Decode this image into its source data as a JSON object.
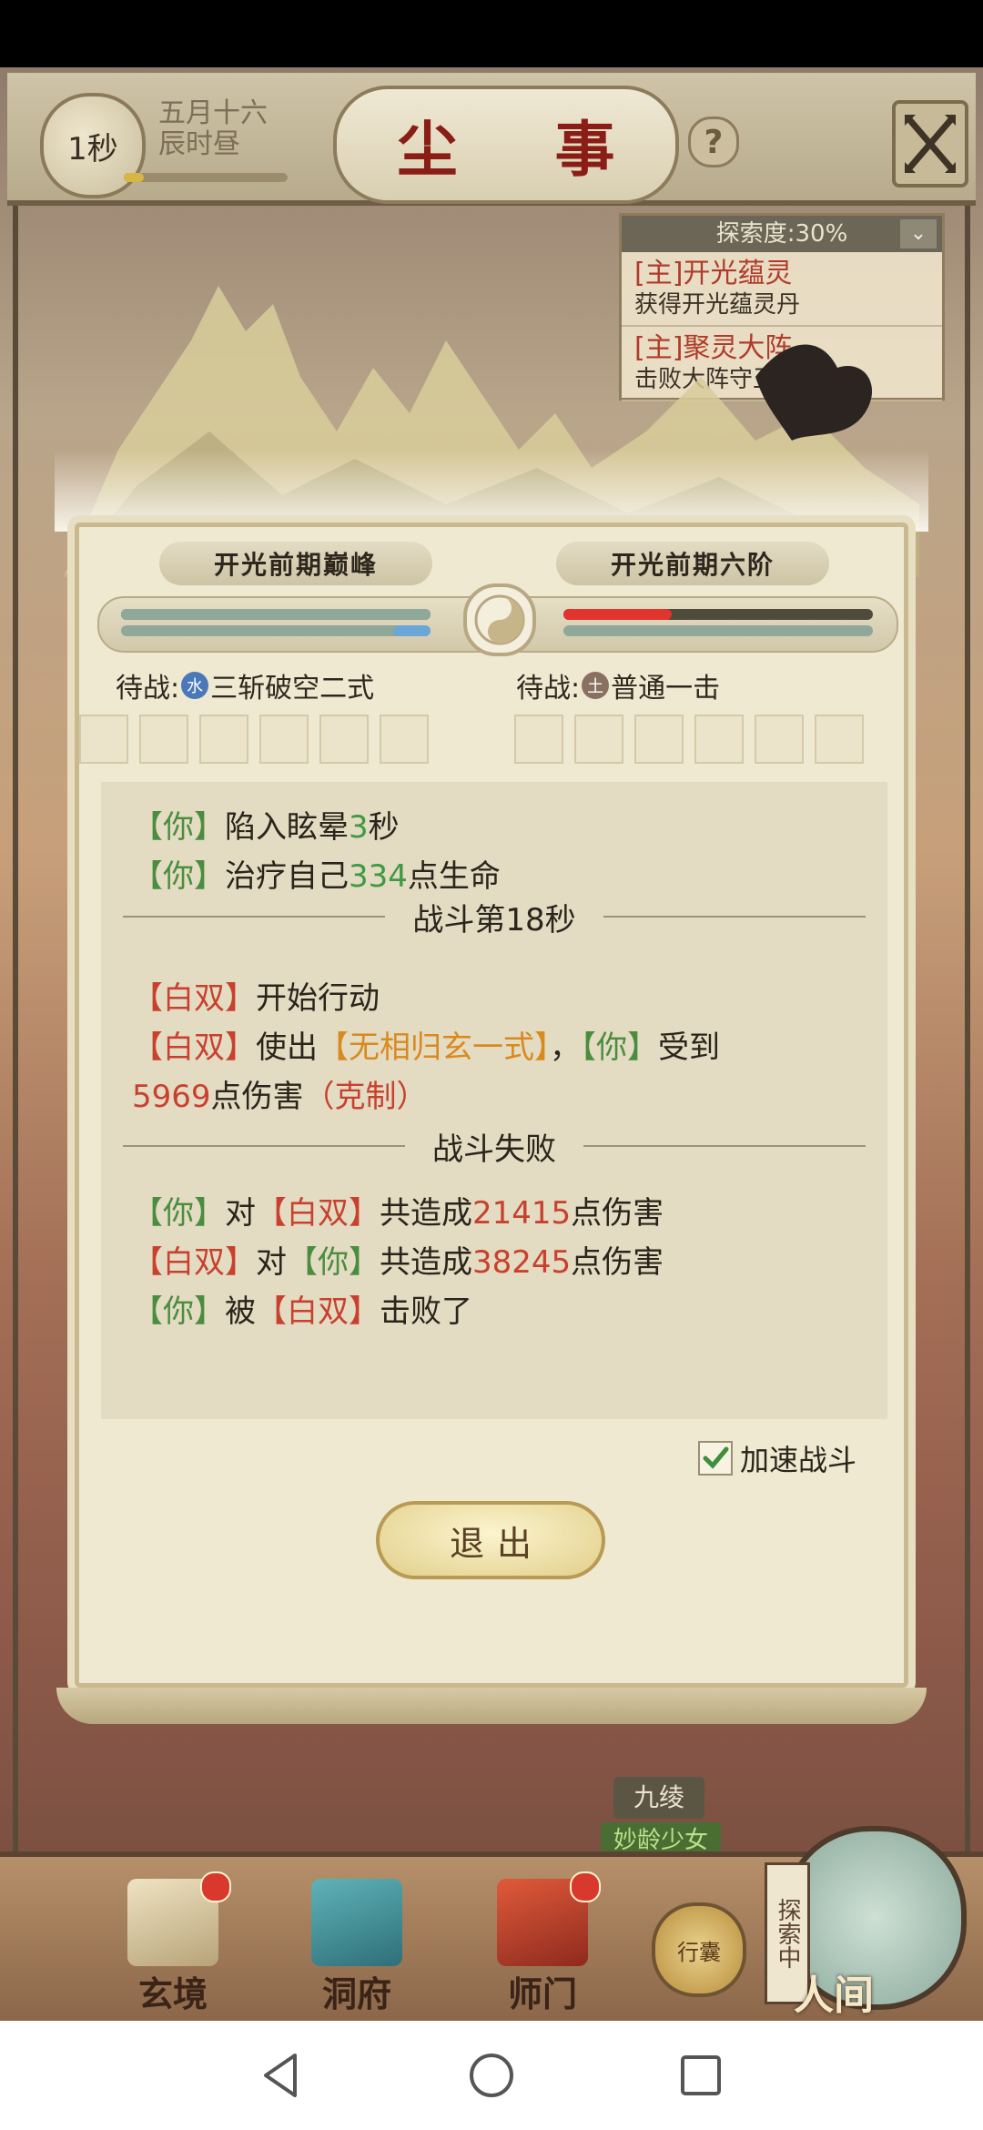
{
  "top_bar": {
    "timer": "1秒",
    "date_line1": "五月十六",
    "date_line2": "辰时昼",
    "title": "尘 事",
    "help_glyph": "?",
    "close_icon": "close-x-icon"
  },
  "quest_panel": {
    "header": "探索度:30%",
    "toggle_glyph": "⌄",
    "items": [
      {
        "title": "[主]开光蕴灵",
        "desc": "获得开光蕴灵丹"
      },
      {
        "title": "[主]聚灵大阵",
        "desc": "击败大阵守卫"
      }
    ]
  },
  "battle": {
    "left_name": "开光前期巅峰",
    "right_name": "开光前期六阶",
    "left_hp_fraction": 1.0,
    "left_mp_fraction": 0.12,
    "right_hp_fraction": 0.35,
    "left_waiting_label": "待战:",
    "left_element": "水",
    "left_skill": "三斩破空二式",
    "right_waiting_label": "待战:",
    "right_element": "土",
    "right_skill": "普通一击",
    "colors": {
      "hp_red": "#e0342c",
      "mp_blue": "#6aa6d8",
      "bar_green": "#8fa89a"
    }
  },
  "log": {
    "l1_who": "【你】",
    "l1_text": "陷入眩晕",
    "l1_num": "3",
    "l1_unit": "秒",
    "l2_who": "【你】",
    "l2_text": "治疗自己",
    "l2_num": "334",
    "l2_unit": "点生命",
    "divider1": "战斗第18秒",
    "l3_who": "【白双】",
    "l3_text": "开始行动",
    "l4_who": "【白双】",
    "l4_text": "使出",
    "l4_skill": "【无相归玄一式】",
    "l4_comma": "，",
    "l4_target": "【你】",
    "l4_tail": "受到",
    "l5_num": "5969",
    "l5_text": "点伤害",
    "l5_tag": "（克制）",
    "divider2": "战斗失败",
    "l6_who": "【你】",
    "l6_mid": "对",
    "l6_target": "【白双】",
    "l6_text": "共造成",
    "l6_num": "21415",
    "l6_tail": "点伤害",
    "l7_who": "【白双】",
    "l7_mid": "对",
    "l7_target": "【你】",
    "l7_text": "共造成",
    "l7_num": "38245",
    "l7_tail": "点伤害",
    "l8_who": "【你】",
    "l8_mid": "被",
    "l8_target": "【白双】",
    "l8_tail": "击败了"
  },
  "controls": {
    "speed_label": "加速战斗",
    "speed_checked": true,
    "exit_label": "退出"
  },
  "npc": {
    "name": "九绫",
    "title": "妙龄少女"
  },
  "bottom_nav": {
    "items": [
      {
        "label": "玄境",
        "icon": "scroll-icon"
      },
      {
        "label": "洞府",
        "icon": "pavilion-icon"
      },
      {
        "label": "师门",
        "icon": "banner-icon"
      }
    ],
    "bag_label": "行囊",
    "explore_tag": "探索中",
    "world_label": "人间"
  }
}
